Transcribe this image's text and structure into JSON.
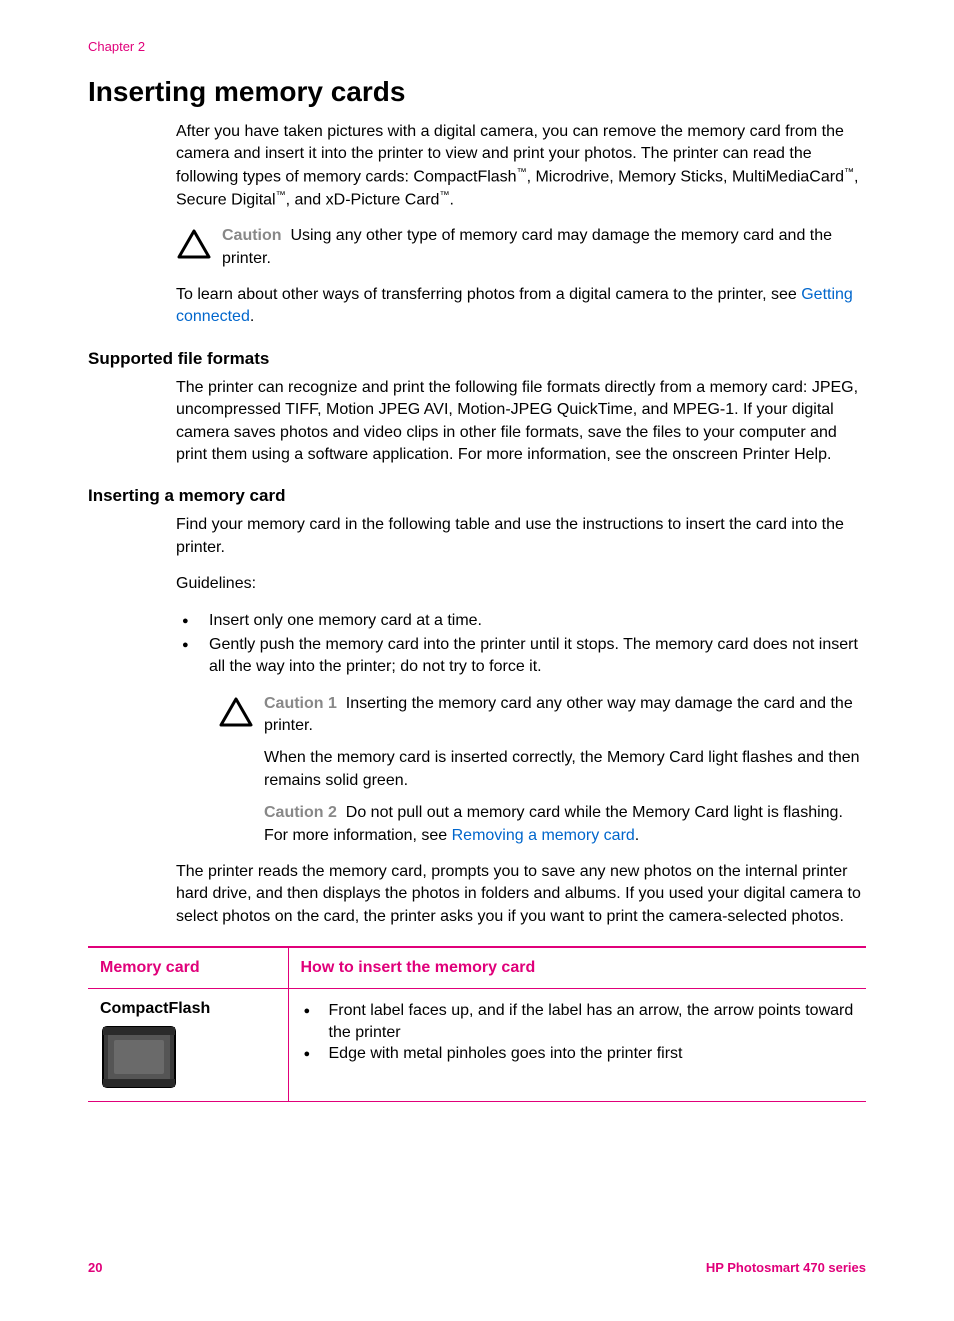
{
  "header": {
    "chapter": "Chapter 2"
  },
  "title": "Inserting memory cards",
  "intro": {
    "part1": "After you have taken pictures with a digital camera, you can remove the memory card from the camera and insert it into the printer to view and print your photos. The printer can read the following types of memory cards: CompactFlash",
    "tm1": "™",
    "part2": ", Microdrive, Memory Sticks, MultiMediaCard",
    "tm2": "™",
    "part3": ", Secure Digital",
    "tm3": "™",
    "part4": ", and xD-Picture Card",
    "tm4": "™",
    "part5": "."
  },
  "caution1": {
    "label": "Caution",
    "text": "Using any other type of memory card may damage the memory card and the printer."
  },
  "learn": {
    "prefix": "To learn about other ways of transferring photos from a digital camera to the printer, see ",
    "link": "Getting connected",
    "suffix": "."
  },
  "section1": {
    "title": "Supported file formats",
    "body": "The printer can recognize and print the following file formats directly from a memory card: JPEG, uncompressed TIFF, Motion JPEG AVI, Motion-JPEG QuickTime, and MPEG-1. If your digital camera saves photos and video clips in other file formats, save the files to your computer and print them using a software application. For more information, see the onscreen Printer Help."
  },
  "section2": {
    "title": "Inserting a memory card",
    "intro": "Find your memory card in the following table and use the instructions to insert the card into the printer.",
    "guidelines_label": "Guidelines:",
    "bullets": [
      "Insert only one memory card at a time.",
      "Gently push the memory card into the printer until it stops. The memory card does not insert all the way into the printer; do not try to force it."
    ],
    "caution1": {
      "label": "Caution 1",
      "text": "Inserting the memory card any other way may damage the card and the printer."
    },
    "inserted_ok": "When the memory card is inserted correctly, the Memory Card light flashes and then remains solid green.",
    "caution2": {
      "label": "Caution 2",
      "prefix": "Do not pull out a memory card while the Memory Card light is flashing. For more information, see ",
      "link": "Removing a memory card",
      "suffix": "."
    },
    "after": "The printer reads the memory card, prompts you to save any new photos on the internal printer hard drive, and then displays the photos in folders and albums. If you used your digital camera to select photos on the card, the printer asks you if you want to print the camera-selected photos."
  },
  "table": {
    "headers": [
      "Memory card",
      "How to insert the memory card"
    ],
    "row1": {
      "name": "CompactFlash",
      "instructions": [
        "Front label faces up, and if the label has an arrow, the arrow points toward the printer",
        "Edge with metal pinholes goes into the printer first"
      ]
    }
  },
  "footer": {
    "page": "20",
    "product": "HP Photosmart 470 series"
  }
}
